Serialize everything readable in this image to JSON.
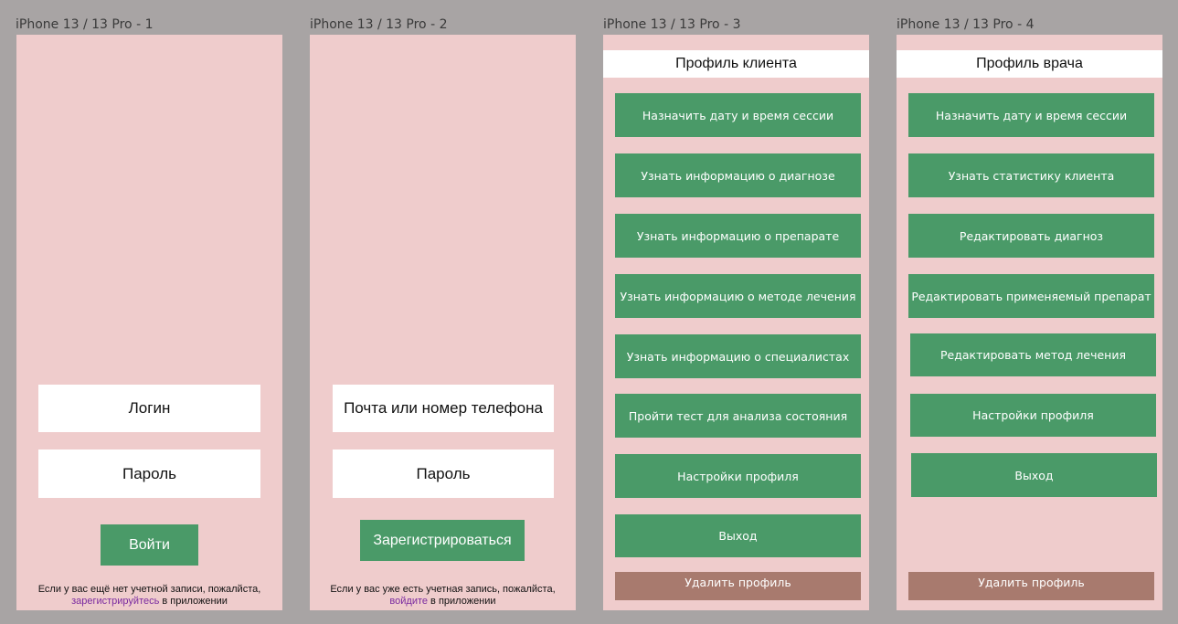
{
  "frames": [
    {
      "label": "iPhone 13 / 13 Pro - 1",
      "login_field": "Логин",
      "password_field": "Пароль",
      "submit_label": "Войти",
      "hint_before": "Если у вас ещё нет учетной записи, пожалйста,",
      "hint_link": "зарегистрируйтесь",
      "hint_after": " в приложении"
    },
    {
      "label": "iPhone 13 / 13 Pro - 2",
      "contact_field": "Почта или номер телефона",
      "password_field": "Пароль",
      "submit_label": "Зарегистрироваться",
      "hint_before": "Если у вас уже есть учетная запись, пожалйста,",
      "hint_link": "войдите",
      "hint_after": " в приложении"
    },
    {
      "label": "iPhone 13 / 13 Pro - 3",
      "title": "Профиль клиента",
      "menu": [
        "Назначить дату и время сессии",
        "Узнать информацию о диагнозе",
        "Узнать информацию о препарате",
        "Узнать информацию о методе лечения",
        "Узнать информацию о специалистах",
        "Пройти тест для анализа состояния",
        "Настройки профиля",
        "Выход"
      ],
      "delete_label": "Удалить профиль"
    },
    {
      "label": "iPhone 13 / 13 Pro - 4",
      "title": "Профиль врача",
      "menu": [
        "Назначить дату и время сессии",
        "Узнать статистику клиента",
        "Редактировать диагноз",
        "Редактировать применяемый препарат",
        "Редактировать метод лечения",
        "Настройки профиля",
        "Выход"
      ],
      "delete_label": "Удалить профиль"
    }
  ],
  "colors": {
    "canvas": "#a8a4a4",
    "frame_bg": "#efcccc",
    "button_green": "#4a9a68",
    "button_delete": "#a87a6e",
    "link": "#7a2aa0"
  }
}
